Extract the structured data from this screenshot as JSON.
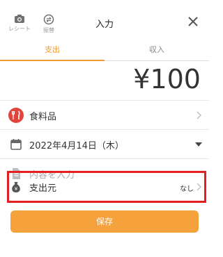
{
  "header": {
    "receipt_label": "レシート",
    "replace_label": "振替",
    "title": "入力"
  },
  "tabs": [
    {
      "label": "支出",
      "active": true
    },
    {
      "label": "収入",
      "active": false
    }
  ],
  "amount": "¥100",
  "category": {
    "label": "食料品",
    "icon": "fork-knife-icon",
    "color": "#e0443b"
  },
  "date": {
    "label": "2022年4月14日（木）"
  },
  "memo": {
    "placeholder": "内容を入力"
  },
  "source": {
    "label": "支出元",
    "value": "なし"
  },
  "save_label": "保存",
  "colors": {
    "accent": "#f39a2e",
    "button": "#f5a23c",
    "highlight": "#e41f1f"
  }
}
